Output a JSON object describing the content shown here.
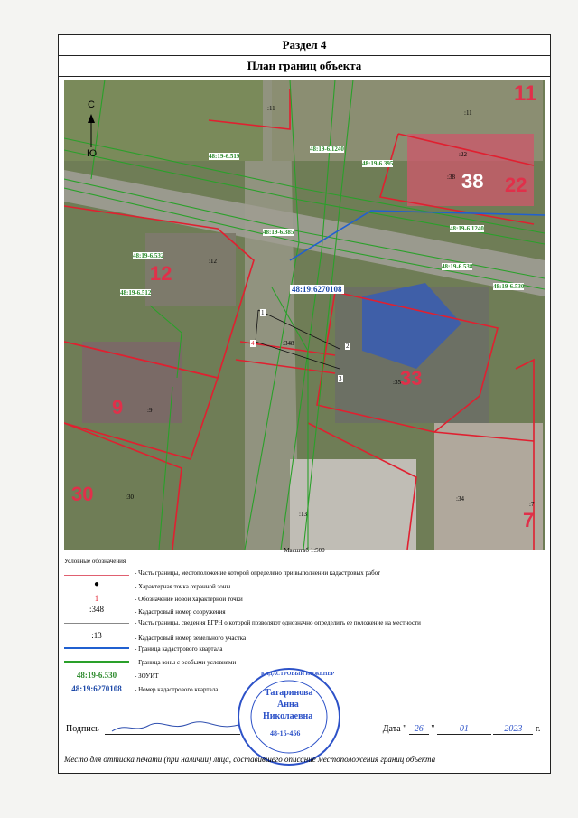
{
  "header": {
    "section": "Раздел 4",
    "title": "План границ объекта"
  },
  "map": {
    "north_label": "С",
    "south_label": "Ю",
    "quarter_number": "48:19:6270108",
    "zone_labels": [
      "48:19-6.1240",
      "48:19-6.519",
      "48:19-6.395",
      "48:19-6.1240",
      "48:19-6.385",
      "48:19-6.532",
      "48:19-6.512",
      "48:19-6.538",
      "48:19-6.530"
    ],
    "parcel_labels": [
      ":11",
      ":11",
      ":22",
      ":38",
      ":12",
      ":348",
      ":35",
      ":9",
      ":30",
      ":13",
      ":34",
      ":7"
    ],
    "house_numbers": [
      "11",
      "38",
      "22",
      "12",
      "9",
      "33",
      "30",
      "7"
    ],
    "point_labels": [
      "1",
      "2",
      "3",
      "4"
    ]
  },
  "scale": "Масштаб 1:500",
  "legend": {
    "title": "Условные обозначения",
    "items": [
      {
        "symbol": "",
        "text": "- Часть границы, местоположение которой определено при выполнении кадастровых работ"
      },
      {
        "symbol": "●",
        "text": "- Характерная точка охранной зоны"
      },
      {
        "symbol": "1",
        "text": "- Обозначение новой характерной точки"
      },
      {
        "symbol": ":348",
        "text": "- Кадастровый номер сооружения"
      },
      {
        "symbol": "",
        "text": "- Часть границы, сведения ЕГРН о которой позволяют однозначно определить ее положение на местности"
      },
      {
        "symbol": ":13",
        "text": "- Кадастровый номер земельного участка"
      },
      {
        "symbol": "",
        "text": "- Граница кадастрового квартала"
      },
      {
        "symbol": "",
        "text": "- Граница зоны с особыми условиями"
      },
      {
        "symbol": "48:19-6.530",
        "text": "- ЗОУИТ"
      },
      {
        "symbol": "48:19:6270108",
        "text": "- Номер кадастрового квартала"
      }
    ]
  },
  "signature": {
    "label": "Подпись",
    "date_label": "Дата \"",
    "day": "26",
    "month": "01",
    "year": "2023",
    "year_suffix": "г."
  },
  "stamp": {
    "top_text": "КАДАСТРОВЫЙ ИНЖЕНЕР",
    "name1": "Татаринова",
    "name2": "Анна",
    "name3": "Николаевна",
    "reg": "48-15-456"
  },
  "footer": "Место для оттиска печати (при наличии) лица, составившего описание местоположения границ объекта"
}
